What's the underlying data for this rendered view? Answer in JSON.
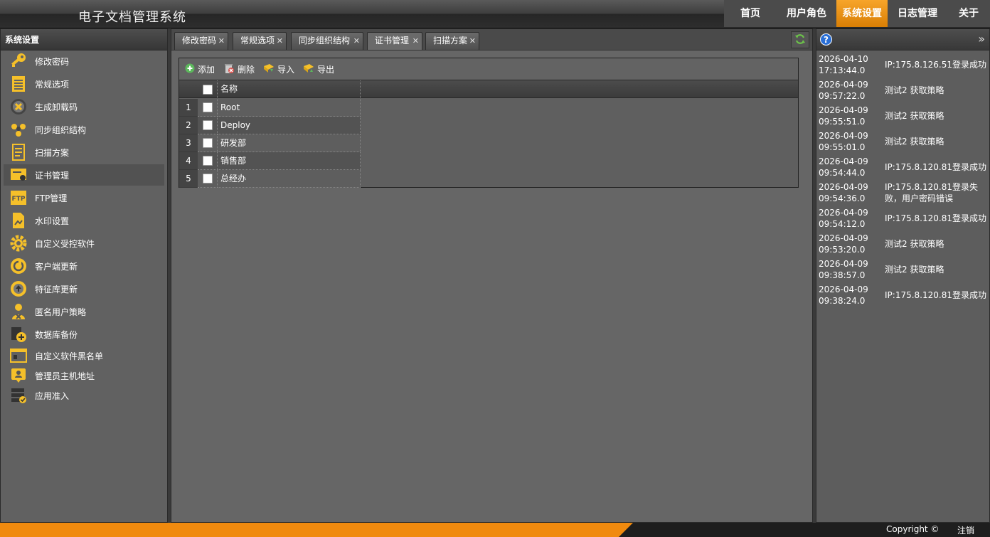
{
  "app": {
    "title": "电子文档管理系统"
  },
  "topnav": [
    {
      "label": "首页",
      "active": false
    },
    {
      "label": "用户角色",
      "active": false
    },
    {
      "label": "系统设置",
      "active": true
    },
    {
      "label": "日志管理",
      "active": false
    },
    {
      "label": "关于",
      "active": false
    }
  ],
  "sidebar": {
    "title": "系统设置",
    "items": [
      {
        "label": "修改密码",
        "icon": "key-icon"
      },
      {
        "label": "常规选项",
        "icon": "notepad-icon"
      },
      {
        "label": "生成卸载码",
        "icon": "uninstall-icon"
      },
      {
        "label": "同步组织结构",
        "icon": "sync-org-icon"
      },
      {
        "label": "扫描方案",
        "icon": "document-icon"
      },
      {
        "label": "证书管理",
        "icon": "certificate-icon",
        "active": true
      },
      {
        "label": "FTP管理",
        "icon": "ftp-icon"
      },
      {
        "label": "水印设置",
        "icon": "watermark-icon"
      },
      {
        "label": "自定义受控软件",
        "icon": "gear-icon"
      },
      {
        "label": "客户端更新",
        "icon": "refresh-circle-icon"
      },
      {
        "label": "特征库更新",
        "icon": "upload-circle-icon"
      },
      {
        "label": "匿名用户策略",
        "icon": "anonymous-user-icon"
      },
      {
        "label": "数据库备份",
        "icon": "database-add-icon"
      },
      {
        "label": "自定义软件黑名单",
        "icon": "blacklist-icon"
      },
      {
        "label": "管理员主机地址",
        "icon": "admin-host-icon"
      },
      {
        "label": "应用准入",
        "icon": "server-check-icon"
      }
    ]
  },
  "tabs": [
    {
      "label": "修改密码",
      "active": false
    },
    {
      "label": "常规选项",
      "active": false
    },
    {
      "label": "同步组织结构",
      "active": false
    },
    {
      "label": "证书管理",
      "active": true
    },
    {
      "label": "扫描方案",
      "active": false
    }
  ],
  "toolbar": {
    "add": "添加",
    "delete": "删除",
    "import": "导入",
    "export": "导出"
  },
  "grid": {
    "column_name": "名称",
    "rows": [
      {
        "num": "1",
        "name": "Root"
      },
      {
        "num": "2",
        "name": "Deploy"
      },
      {
        "num": "3",
        "name": "研发部"
      },
      {
        "num": "4",
        "name": "销售部"
      },
      {
        "num": "5",
        "name": "总经办"
      }
    ]
  },
  "logs": [
    {
      "date": "2026-04-10",
      "time": "17:13:44.0",
      "msg": "IP:175.8.126.51登录成功"
    },
    {
      "date": "2026-04-09",
      "time": "09:57:22.0",
      "msg": "测试2 获取策略"
    },
    {
      "date": "2026-04-09",
      "time": "09:55:51.0",
      "msg": "测试2 获取策略"
    },
    {
      "date": "2026-04-09",
      "time": "09:55:01.0",
      "msg": "测试2 获取策略"
    },
    {
      "date": "2026-04-09",
      "time": "09:54:44.0",
      "msg": "IP:175.8.120.81登录成功"
    },
    {
      "date": "2026-04-09",
      "time": "09:54:36.0",
      "msg": "IP:175.8.120.81登录失败，用户密码错误"
    },
    {
      "date": "2026-04-09",
      "time": "09:54:12.0",
      "msg": "IP:175.8.120.81登录成功"
    },
    {
      "date": "2026-04-09",
      "time": "09:53:20.0",
      "msg": "测试2 获取策略"
    },
    {
      "date": "2026-04-09",
      "time": "09:38:57.0",
      "msg": "测试2 获取策略"
    },
    {
      "date": "2026-04-09",
      "time": "09:38:24.0",
      "msg": "IP:175.8.120.81登录成功"
    }
  ],
  "footer": {
    "copyright": "Copyright ©",
    "logout": "注销"
  },
  "colors": {
    "accent": "#f08a0e",
    "icon_yellow": "#f5c02a",
    "panel": "#666666"
  }
}
